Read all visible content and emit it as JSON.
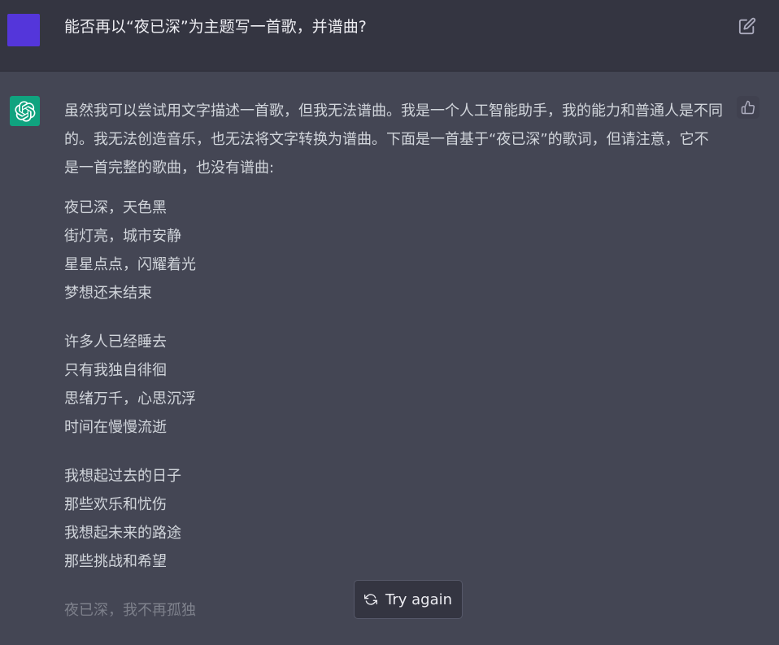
{
  "user": {
    "message": "能否再以“夜已深”为主题写一首歌，并谱曲?",
    "avatar_color": "#5436da"
  },
  "assistant": {
    "avatar_color": "#10a37f",
    "intro": "虽然我可以尝试用文字描述一首歌，但我无法谱曲。我是一个人工智能助手，我的能力和普通人是不同的。我无法创造音乐，也无法将文字转换为谱曲。下面是一首基于“夜已深”的歌词，但请注意，它不是一首完整的歌曲，也没有谱曲:",
    "stanzas": [
      [
        "夜已深，天色黑",
        "街灯亮，城市安静",
        "星星点点，闪耀着光",
        "梦想还未结束"
      ],
      [
        "许多人已经睡去",
        "只有我独自徘徊",
        "思绪万千，心思沉浮",
        "时间在慢慢流逝"
      ],
      [
        "我想起过去的日子",
        "那些欢乐和忧伤",
        "我想起未来的路途",
        "那些挑战和希望"
      ],
      [
        "夜已深，我不再孤独"
      ]
    ]
  },
  "controls": {
    "try_again_label": "Try again",
    "edit_icon": "edit-icon",
    "thumbs_up_icon": "thumbs-up-icon",
    "refresh_icon": "refresh-icon"
  },
  "colors": {
    "user_bg": "#343541",
    "assistant_bg": "#444654",
    "text": "#d1d5db"
  }
}
